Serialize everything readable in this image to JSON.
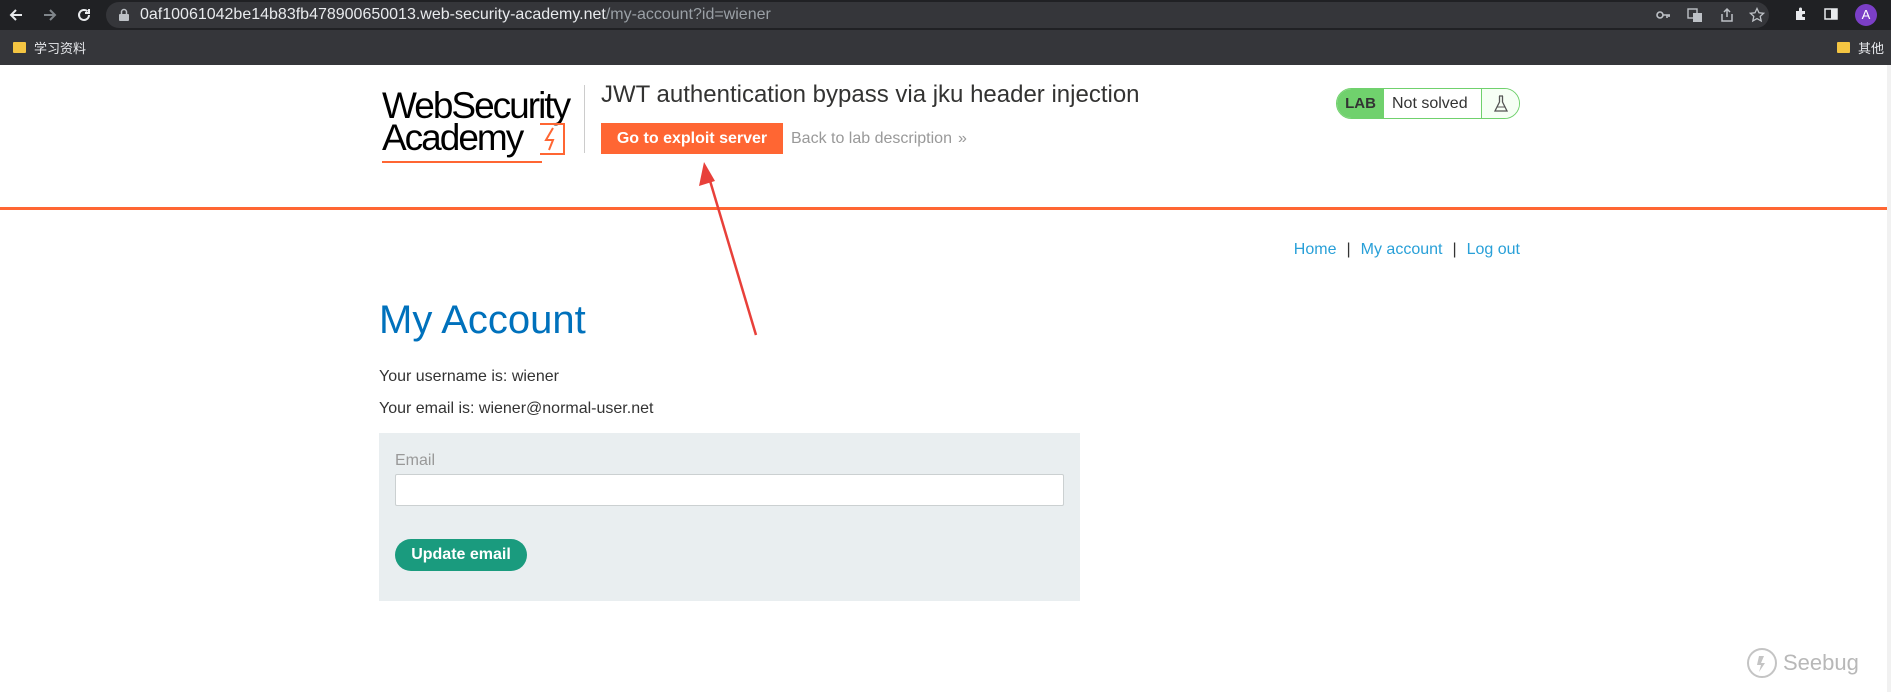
{
  "browser": {
    "url_host": "0af10061042be14b83fb478900650013.web-security-academy.net",
    "url_path": "/my-account?id=wiener",
    "avatar_letter": "A",
    "bookmarks": [
      {
        "label": "学习资料",
        "icon": "folder-icon"
      },
      {
        "label": "其他",
        "icon": "folder-icon"
      }
    ]
  },
  "header": {
    "logo_line1": "WebSecurity",
    "logo_line2": "Academy",
    "lab_title": "JWT authentication bypass via jku header injection",
    "exploit_button": "Go to exploit server",
    "back_link": "Back to lab description",
    "back_chevron": "»",
    "lab_badge": {
      "label": "LAB",
      "status": "Not solved",
      "icon": "flask-icon"
    }
  },
  "nav": {
    "items": [
      "Home",
      "My account",
      "Log out"
    ],
    "separator": "|"
  },
  "main": {
    "title": "My Account",
    "username_line": "Your username is: wiener",
    "email_line": "Your email is: wiener@normal-user.net",
    "form": {
      "email_label": "Email",
      "email_value": "",
      "email_placeholder": "",
      "submit": "Update email"
    }
  },
  "watermark": "Seebug",
  "colors": {
    "accent_orange": "#ff6633",
    "link_blue": "#29a0d8",
    "heading_blue": "#0071bc",
    "lab_green": "#70d16d",
    "button_teal": "#1a9b7e",
    "annotation_red": "#e8403a"
  }
}
